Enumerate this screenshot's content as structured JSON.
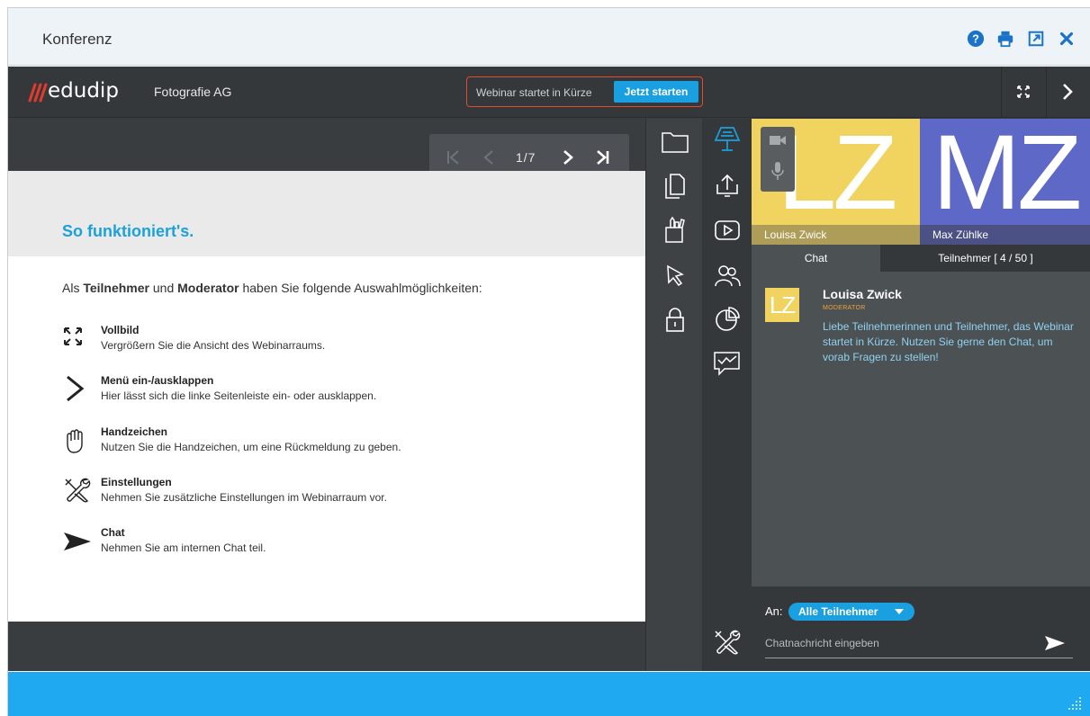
{
  "dialog": {
    "title": "Konferenz",
    "icons": [
      "help-icon",
      "print-icon",
      "external-link-icon",
      "close-icon"
    ],
    "accent_color": "#1a73c8"
  },
  "app": {
    "logo_text": "edudip",
    "company": "Fotografie AG",
    "webinar_message": "Webinar startet in Kürze",
    "start_label": "Jetzt starten",
    "icons": [
      "fullscreen-icon",
      "chevron-right-icon"
    ]
  },
  "presentation": {
    "page_indicator": "1/7",
    "slide": {
      "title": "So funktioniert's.",
      "intro_prefix": "Als ",
      "intro_role1": "Teilnehmer",
      "intro_mid": " und ",
      "intro_role2": "Moderator",
      "intro_suffix": " haben Sie folgende Auswahlmöglichkeiten:",
      "features": [
        {
          "icon": "fullscreen-icon",
          "title": "Vollbild",
          "desc": "Vergrößern Sie die Ansicht des Webinarraums."
        },
        {
          "icon": "chevron-right-icon",
          "title": "Menü ein-/ausklappen",
          "desc": "Hier lässt sich die linke Seitenleiste ein- oder ausklappen."
        },
        {
          "icon": "hand-raise-icon",
          "title": "Handzeichen",
          "desc": "Nutzen Sie die Handzeichen, um eine Rückmeldung zu geben."
        },
        {
          "icon": "settings-tools-icon",
          "title": "Einstellungen",
          "desc": "Nehmen Sie zusätzliche Einstellungen im Webinarraum vor."
        },
        {
          "icon": "send-icon",
          "title": "Chat",
          "desc": "Nehmen Sie am internen Chat teil."
        }
      ]
    }
  },
  "tools_left": [
    "folder-icon",
    "documents-icon",
    "pens-icon",
    "pointer-icon",
    "lock-icon"
  ],
  "tools_right": [
    "presentation-icon",
    "share-screen-icon",
    "video-play-icon",
    "users-icon",
    "poll-icon",
    "chat-poll-icon",
    "settings-tools-icon"
  ],
  "videos": [
    {
      "initials": "LZ",
      "name": "Louisa Zwick",
      "color": "#f1d35f"
    },
    {
      "initials": "MZ",
      "name": "Max Zühlke",
      "color": "#5e68c6"
    }
  ],
  "tabs": {
    "chat": "Chat",
    "participants": "Teilnehmer [ 4 / 50 ]"
  },
  "chat": {
    "message": {
      "avatar": "LZ",
      "author": "Louisa Zwick",
      "role": "MODERATOR",
      "text": "Liebe Teilnehmerinnen und Teilnehmer, das Webinar startet in Kürze. Nutzen Sie gerne den Chat, um vorab Fragen zu stellen!"
    },
    "to_label": "An:",
    "to_value": "Alle Teilnehmer",
    "input_placeholder": "Chatnachricht eingeben"
  }
}
